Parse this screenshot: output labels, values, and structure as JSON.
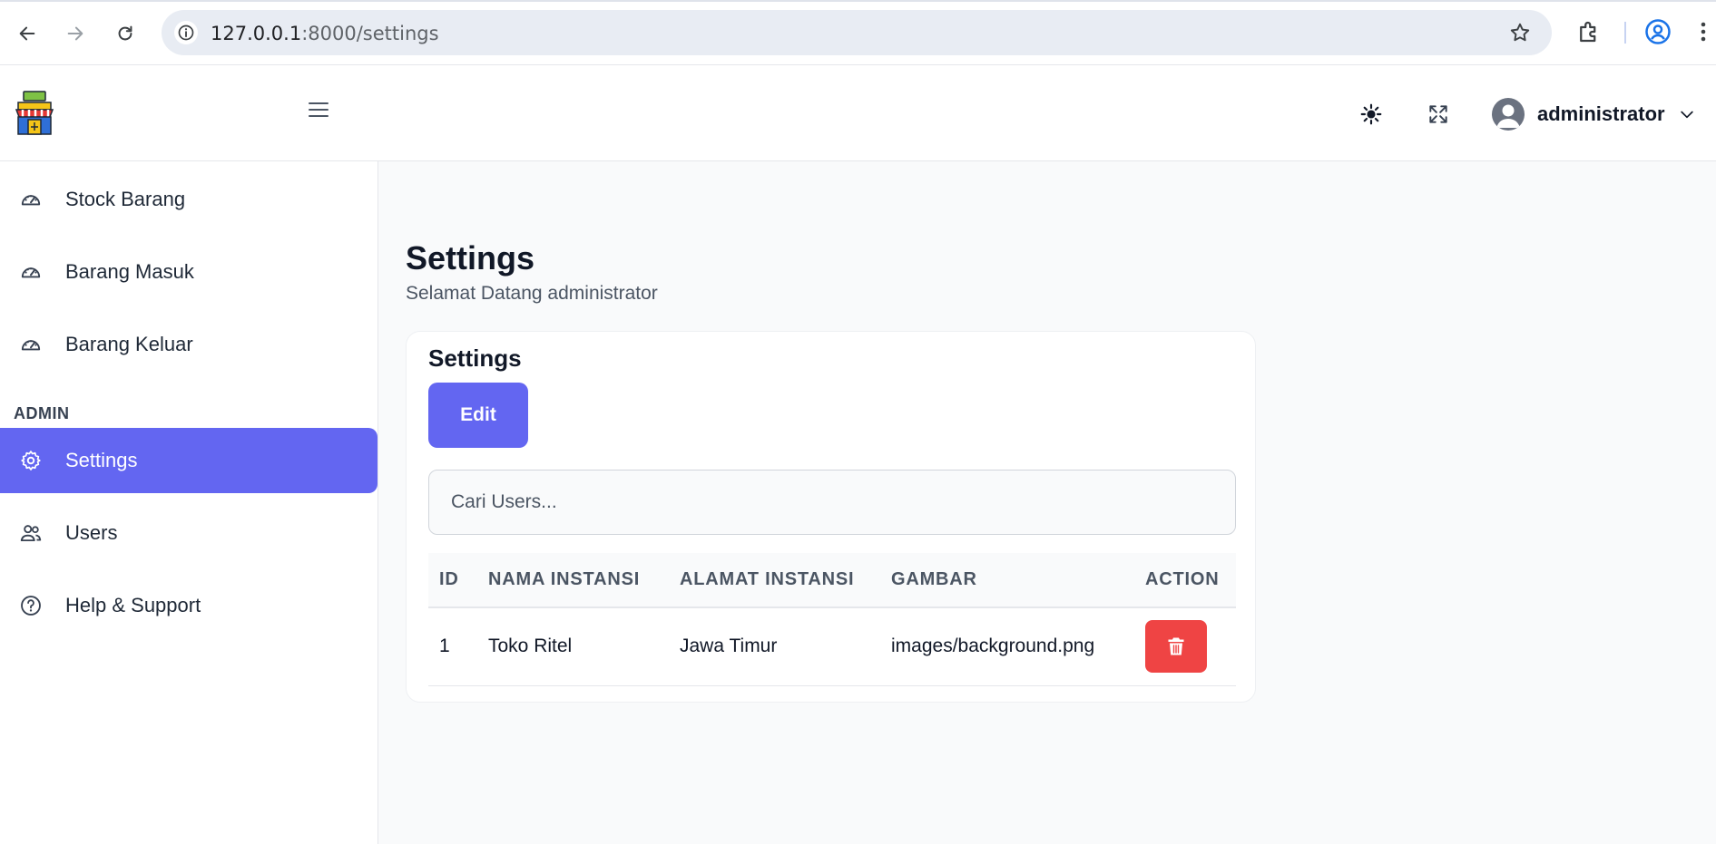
{
  "browser": {
    "url_host": "127.0.0.1",
    "url_path": ":8000/settings"
  },
  "header": {
    "username": "administrator"
  },
  "sidebar": {
    "items": [
      {
        "label": "Stock Barang",
        "icon": "gauge-icon"
      },
      {
        "label": "Barang Masuk",
        "icon": "gauge-icon"
      },
      {
        "label": "Barang Keluar",
        "icon": "gauge-icon"
      }
    ],
    "admin_heading": "ADMIN",
    "admin_items": [
      {
        "label": "Settings",
        "icon": "gear-icon",
        "active": true
      },
      {
        "label": "Users",
        "icon": "users-icon"
      },
      {
        "label": "Help & Support",
        "icon": "help-icon"
      }
    ]
  },
  "main": {
    "title": "Settings",
    "subtitle": "Selamat Datang administrator",
    "card": {
      "title": "Settings",
      "edit_label": "Edit",
      "search_placeholder": "Cari Users...",
      "columns": [
        "ID",
        "NAMA INSTANSI",
        "ALAMAT INSTANSI",
        "GAMBAR",
        "ACTION"
      ],
      "rows": [
        {
          "id": "1",
          "nama": "Toko Ritel",
          "alamat": "Jawa Timur",
          "gambar": "images/background.png"
        }
      ]
    }
  },
  "colors": {
    "accent": "#6366f1",
    "danger": "#ef4444"
  }
}
